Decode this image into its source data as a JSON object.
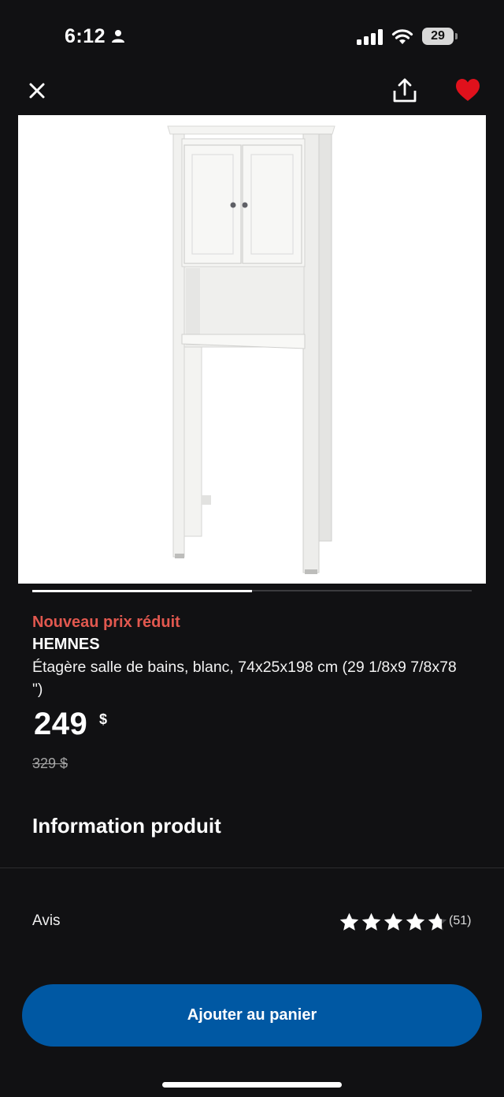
{
  "status_bar": {
    "time": "6:12",
    "battery": "29"
  },
  "header": {
    "close_icon": "close-icon",
    "share_icon": "share-icon",
    "favorite_icon": "heart-icon",
    "favorite_color": "#e0111c"
  },
  "gallery": {
    "image_description_icon": "cabinet-image",
    "progress": 0.5
  },
  "product": {
    "price_label": "Nouveau prix réduit",
    "name": "HEMNES",
    "description": "Étagère salle de bains, blanc, 74x25x198 cm (29 1/8x9 7/8x78 \")",
    "price": "249",
    "currency": "$",
    "old_price": "329 $",
    "price_label_color": "#e2584f"
  },
  "sections": {
    "info_title": "Information produit"
  },
  "reviews": {
    "label": "Avis",
    "rating": 4.7,
    "max_rating": 5,
    "count": "(51)"
  },
  "cta": {
    "add_to_cart": "Ajouter au panier",
    "color": "#0058a3"
  }
}
